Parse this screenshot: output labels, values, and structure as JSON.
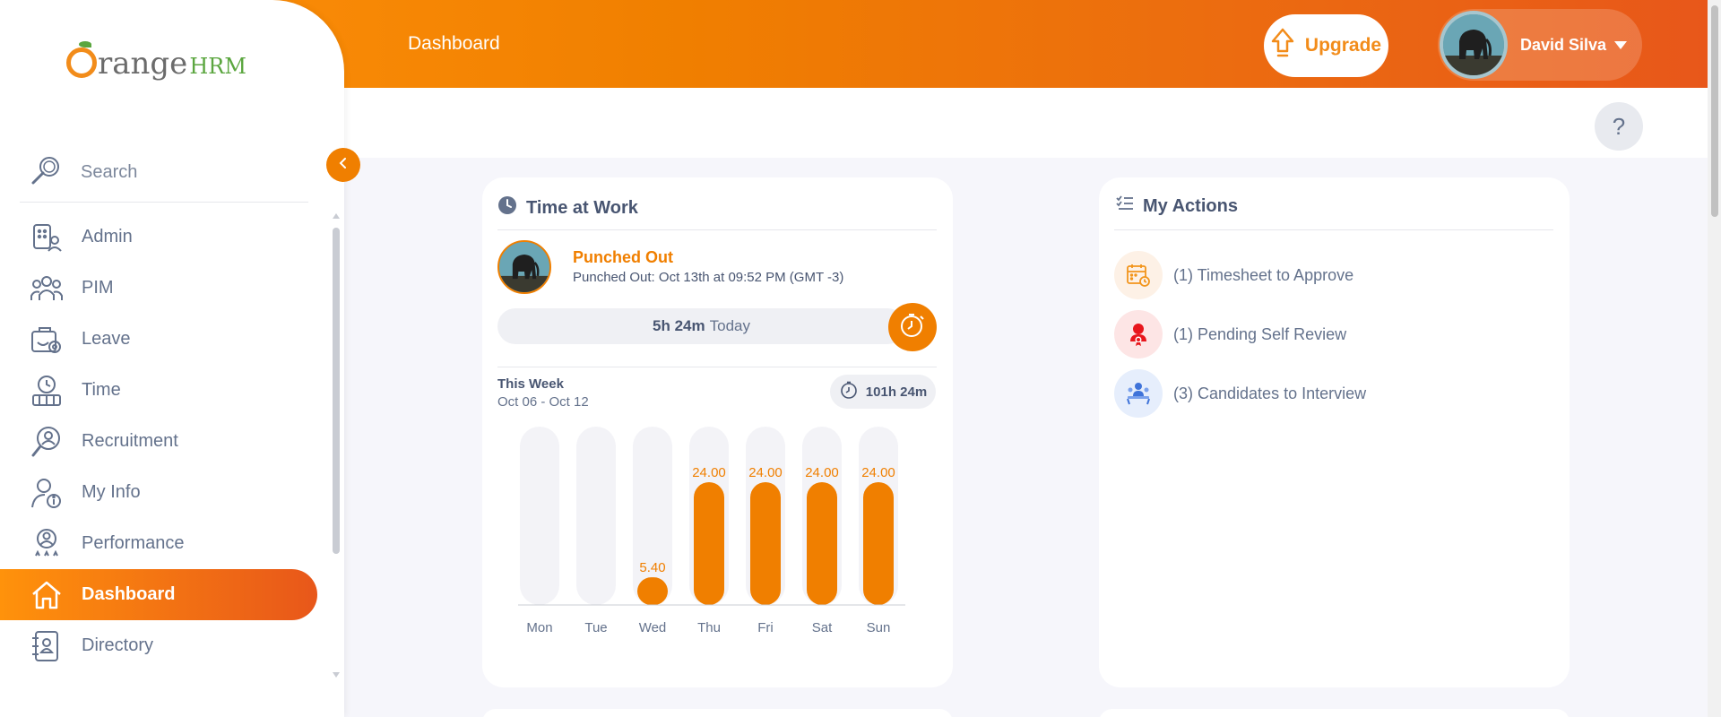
{
  "header": {
    "title": "Dashboard",
    "upgrade_label": "Upgrade",
    "user_name": "David Silva",
    "help_label": "?"
  },
  "sidebar": {
    "search_placeholder": "Search",
    "items": [
      {
        "label": "Admin",
        "icon": "admin-icon"
      },
      {
        "label": "PIM",
        "icon": "pim-icon"
      },
      {
        "label": "Leave",
        "icon": "leave-icon"
      },
      {
        "label": "Time",
        "icon": "time-icon"
      },
      {
        "label": "Recruitment",
        "icon": "recruitment-icon"
      },
      {
        "label": "My Info",
        "icon": "my-info-icon"
      },
      {
        "label": "Performance",
        "icon": "performance-icon"
      },
      {
        "label": "Dashboard",
        "icon": "home-icon",
        "active": true
      },
      {
        "label": "Directory",
        "icon": "directory-icon"
      }
    ]
  },
  "time_at_work": {
    "title": "Time at Work",
    "status": "Punched Out",
    "punch_detail": "Punched Out: Oct 13th at 09:52 PM (GMT -3)",
    "today_hours": "5h 24m",
    "today_label": "Today",
    "week_label": "This Week",
    "week_range": "Oct 06 - Oct 12",
    "week_total": "101h 24m"
  },
  "chart_data": {
    "type": "bar",
    "categories": [
      "Mon",
      "Tue",
      "Wed",
      "Thu",
      "Fri",
      "Sat",
      "Sun"
    ],
    "values": [
      0,
      0,
      5.4,
      24.0,
      24.0,
      24.0,
      24.0
    ],
    "data_labels": [
      "",
      "",
      "5.40",
      "24.00",
      "24.00",
      "24.00",
      "24.00"
    ],
    "ylim": [
      0,
      24
    ],
    "bar_color": "#f07f00",
    "track_color": "#f3f3f7",
    "title": "",
    "xlabel": "",
    "ylabel": ""
  },
  "my_actions": {
    "title": "My Actions",
    "items": [
      {
        "text": "(1) Timesheet to Approve",
        "icon": "timesheet-icon",
        "bg": "#fdf1e6"
      },
      {
        "text": "(1) Pending Self Review",
        "icon": "self-review-icon",
        "bg": "#fde5e5"
      },
      {
        "text": "(3) Candidates to Interview",
        "icon": "interview-icon",
        "bg": "#e6eefc"
      }
    ]
  },
  "colors": {
    "brand_orange": "#f07f00",
    "text": "#64728c",
    "heading": "#485571"
  }
}
